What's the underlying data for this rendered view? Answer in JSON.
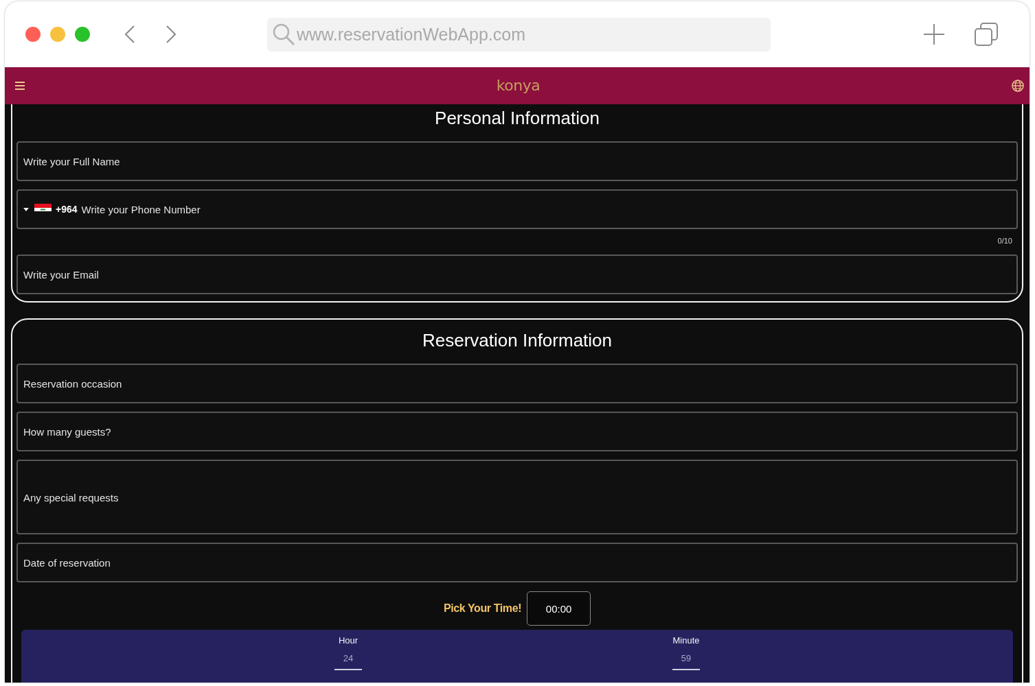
{
  "browser": {
    "url": "www.reservationWebApp.com"
  },
  "header": {
    "logo": "konya"
  },
  "sections": [
    {
      "title": "Personal Information",
      "fields": [
        {
          "kind": "text",
          "placeholder": "Write your Full Name"
        },
        {
          "kind": "phone",
          "dial_code": "+964",
          "placeholder": "Write your Phone Number",
          "counter": "0/10"
        },
        {
          "kind": "text",
          "placeholder": "Write your Email"
        }
      ]
    },
    {
      "title": "Reservation Information",
      "fields": [
        {
          "kind": "text",
          "placeholder": "Reservation occasion"
        },
        {
          "kind": "text",
          "placeholder": "How many guests?"
        },
        {
          "kind": "textarea",
          "placeholder": "Any special requests"
        },
        {
          "kind": "text",
          "placeholder": "Date of reservation"
        }
      ],
      "time": {
        "label": "Pick Your Time!",
        "value": "00:00"
      },
      "time_picker": {
        "columns": [
          {
            "label": "Hour",
            "value": "24"
          },
          {
            "label": "Minute",
            "value": "59"
          }
        ]
      }
    }
  ]
}
